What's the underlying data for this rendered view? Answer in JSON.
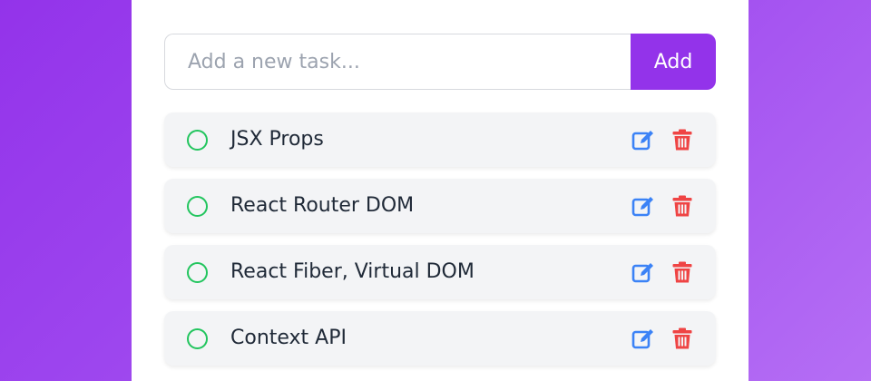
{
  "new_task": {
    "placeholder": "Add a new task...",
    "value": "",
    "add_label": "Add"
  },
  "tasks": [
    {
      "text": "JSX Props",
      "completed": false
    },
    {
      "text": "React Router DOM",
      "completed": false
    },
    {
      "text": "React Fiber, Virtual DOM",
      "completed": false
    },
    {
      "text": "Context API",
      "completed": false
    }
  ],
  "icons": {
    "check": "circle-outline-icon",
    "edit": "edit-icon",
    "delete": "trash-icon"
  },
  "colors": {
    "accent": "#9333ea",
    "check": "#22c55e",
    "edit": "#3b82f6",
    "delete": "#ef4444",
    "item_bg": "#f3f4f6"
  }
}
